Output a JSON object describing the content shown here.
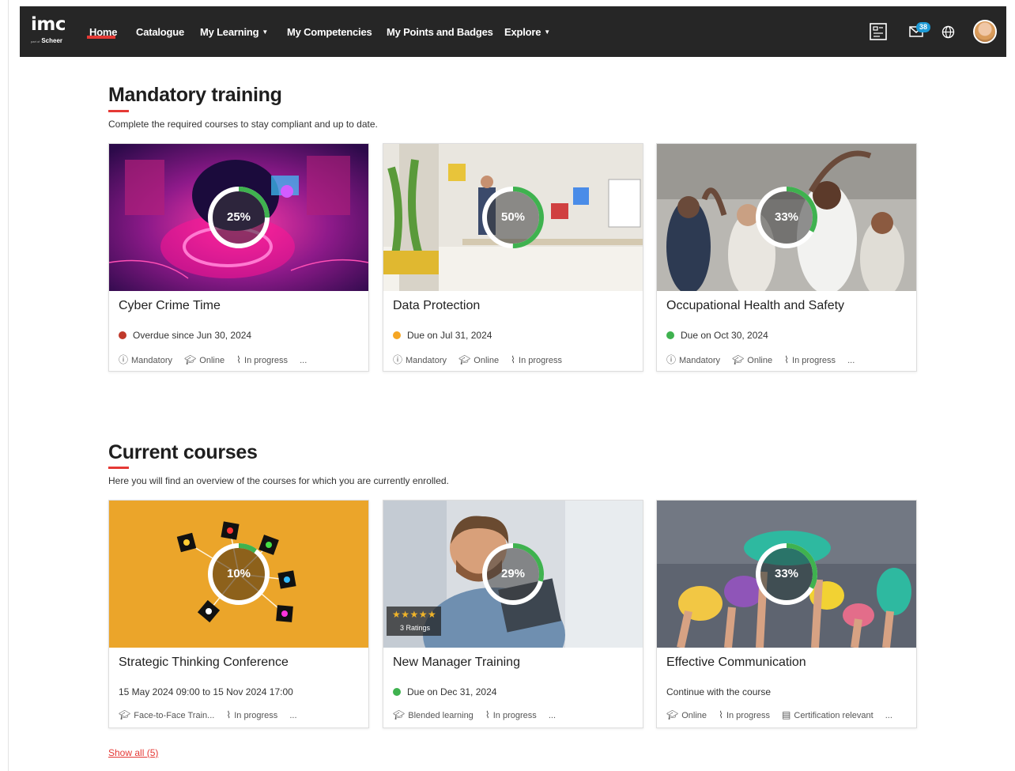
{
  "brand": {
    "name": "imc",
    "sub_small": "part of",
    "sub": "Scheer"
  },
  "nav": {
    "home": "Home",
    "catalogue": "Catalogue",
    "my_learning": "My Learning",
    "my_competencies": "My Competencies",
    "points_badges": "My Points and Badges",
    "explore": "Explore"
  },
  "toolbar": {
    "messages_count": "38"
  },
  "mandatory": {
    "title": "Mandatory training",
    "description": "Complete the required courses to stay compliant and up to date.",
    "cards": [
      {
        "title": "Cyber Crime Time",
        "progress_label": "25%",
        "progress": 0.25,
        "status": "Overdue since Jun 30, 2024",
        "status_color": "#c0392b",
        "meta": [
          "Mandatory",
          "Online",
          "In progress"
        ],
        "more": "..."
      },
      {
        "title": "Data Protection",
        "progress_label": "50%",
        "progress": 0.5,
        "status": "Due on Jul 31, 2024",
        "status_color": "#f5a623",
        "meta": [
          "Mandatory",
          "Online",
          "In progress"
        ],
        "more": ""
      },
      {
        "title": "Occupational Health and Safety",
        "progress_label": "33%",
        "progress": 0.33,
        "status": "Due on Oct 30, 2024",
        "status_color": "#3fb24f",
        "meta": [
          "Mandatory",
          "Online",
          "In progress"
        ],
        "more": "..."
      }
    ]
  },
  "current": {
    "title": "Current courses",
    "description": "Here you will find an overview of the courses for which you are currently enrolled.",
    "cards": [
      {
        "title": "Strategic Thinking Conference",
        "progress_label": "10%",
        "progress": 0.1,
        "status": "15 May 2024 09:00 to 15 Nov 2024 17:00",
        "meta": [
          "Face-to-Face Train...",
          "In progress"
        ],
        "more": "..."
      },
      {
        "title": "New Manager Training",
        "progress_label": "29%",
        "progress": 0.29,
        "status": "Due on Dec 31, 2024",
        "status_color": "#3fb24f",
        "meta": [
          "Blended learning",
          "In progress"
        ],
        "more": "...",
        "rating_stars": "★★★★★",
        "rating_text": "3 Ratings"
      },
      {
        "title": "Effective Communication",
        "progress_label": "33%",
        "progress": 0.33,
        "status": "Continue with the course",
        "meta": [
          "Online",
          "In progress",
          "Certification relevant"
        ],
        "more": "..."
      }
    ],
    "show_all": "Show all (5)"
  },
  "colors": {
    "accent": "#e53935",
    "topbar": "#262626",
    "progress": "#3fb24f",
    "badge": "#1e9bd7"
  }
}
